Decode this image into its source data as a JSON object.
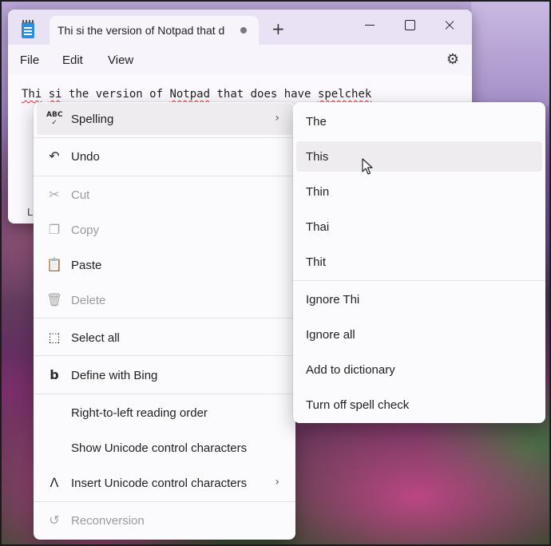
{
  "window": {
    "tab_title": "Thi si the version of Notpad that d",
    "new_tab_label": "+",
    "menus": [
      "File",
      "Edit",
      "View"
    ],
    "editor": {
      "text_parts": [
        "Thi",
        " ",
        "si",
        " the version of ",
        "Notpad",
        " that does have ",
        "spelchek"
      ],
      "misspelled": [
        0,
        2,
        4,
        6
      ]
    },
    "status_partial": "Li"
  },
  "context_menu": {
    "items": [
      {
        "label": "Spelling",
        "icon": "abc-check-icon",
        "submenu": true,
        "disabled": false
      },
      {
        "label": "Undo",
        "icon": "undo-icon",
        "disabled": false
      },
      {
        "label": "Cut",
        "icon": "scissors-icon",
        "disabled": true
      },
      {
        "label": "Copy",
        "icon": "copy-icon",
        "disabled": true
      },
      {
        "label": "Paste",
        "icon": "paste-icon",
        "disabled": false
      },
      {
        "label": "Delete",
        "icon": "trash-icon",
        "disabled": true
      },
      {
        "label": "Select all",
        "icon": "select-all-icon",
        "disabled": false
      },
      {
        "label": "Define with Bing",
        "icon": "bing-icon",
        "disabled": false
      },
      {
        "label": "Right-to-left reading order",
        "disabled": false
      },
      {
        "label": "Show Unicode control characters",
        "disabled": false
      },
      {
        "label": "Insert Unicode control characters",
        "icon": "caret-icon",
        "submenu": true,
        "disabled": false
      },
      {
        "label": "Reconversion",
        "icon": "reconversion-icon",
        "disabled": true
      }
    ]
  },
  "spelling_submenu": {
    "suggestions": [
      "The",
      "This",
      "Thin",
      "Thai",
      "Thit"
    ],
    "actions": [
      "Ignore Thi",
      "Ignore all",
      "Add to dictionary",
      "Turn off spell check"
    ],
    "hovered": "This"
  }
}
